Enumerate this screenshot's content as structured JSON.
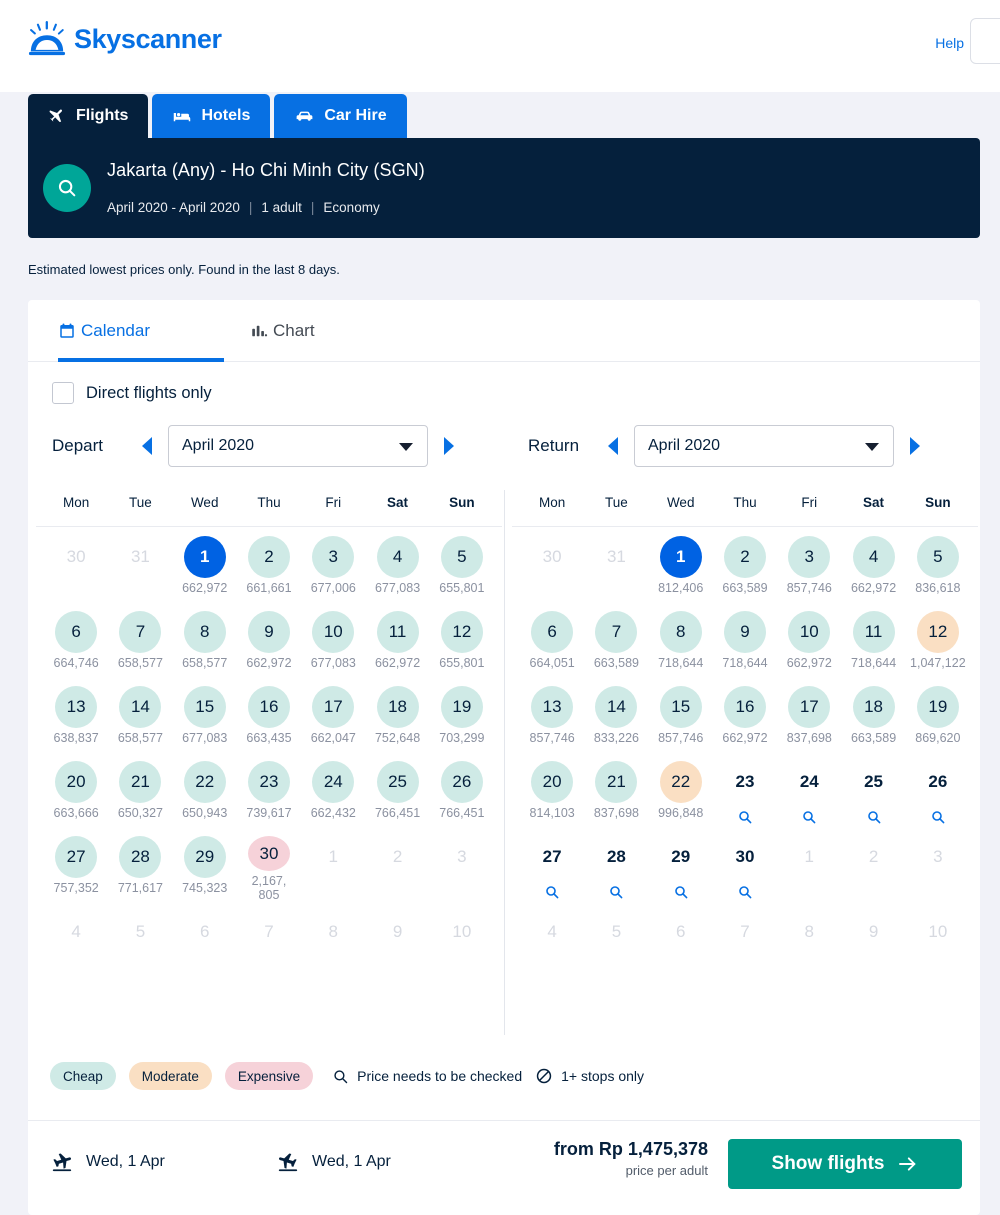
{
  "brand": {
    "name": "Skyscanner",
    "accent": "#0770e3",
    "dark": "#05203c",
    "green": "#009a87"
  },
  "topbar": {
    "help_label": "Help"
  },
  "product_tabs": [
    {
      "label": "Flights",
      "icon": "plane-icon",
      "active": true
    },
    {
      "label": "Hotels",
      "icon": "bed-icon",
      "active": false
    },
    {
      "label": "Car Hire",
      "icon": "car-icon",
      "active": false
    }
  ],
  "search_summary": {
    "route": "Jakarta (Any) - Ho Chi Minh City (SGN)",
    "dates": "April 2020 - April 2020",
    "passengers": "1 adult",
    "cabin": "Economy",
    "icon": "search-icon"
  },
  "estimate_note": "Estimated lowest prices only. Found in the last 8 days.",
  "view_tabs": [
    {
      "label": "Calendar",
      "icon": "calendar-icon",
      "active": true
    },
    {
      "label": "Chart",
      "icon": "bar-chart-icon",
      "active": false
    }
  ],
  "direct_flights": {
    "label": "Direct flights only",
    "checked": false
  },
  "depart": {
    "nav_label": "Depart",
    "month": "April 2020",
    "dow": [
      "Mon",
      "Tue",
      "Wed",
      "Thu",
      "Fri",
      "Sat",
      "Sun"
    ],
    "weeks": [
      [
        {
          "day": "30",
          "state": "muted",
          "price": ""
        },
        {
          "day": "31",
          "state": "muted",
          "price": ""
        },
        {
          "day": "1",
          "state": "selected",
          "price": "662,972"
        },
        {
          "day": "2",
          "state": "cheap",
          "price": "661,661"
        },
        {
          "day": "3",
          "state": "cheap",
          "price": "677,006"
        },
        {
          "day": "4",
          "state": "cheap",
          "price": "677,083"
        },
        {
          "day": "5",
          "state": "cheap",
          "price": "655,801"
        }
      ],
      [
        {
          "day": "6",
          "state": "cheap",
          "price": "664,746"
        },
        {
          "day": "7",
          "state": "cheap",
          "price": "658,577"
        },
        {
          "day": "8",
          "state": "cheap",
          "price": "658,577"
        },
        {
          "day": "9",
          "state": "cheap",
          "price": "662,972"
        },
        {
          "day": "10",
          "state": "cheap",
          "price": "677,083"
        },
        {
          "day": "11",
          "state": "cheap",
          "price": "662,972"
        },
        {
          "day": "12",
          "state": "cheap",
          "price": "655,801"
        }
      ],
      [
        {
          "day": "13",
          "state": "cheap",
          "price": "638,837"
        },
        {
          "day": "14",
          "state": "cheap",
          "price": "658,577"
        },
        {
          "day": "15",
          "state": "cheap",
          "price": "677,083"
        },
        {
          "day": "16",
          "state": "cheap",
          "price": "663,435"
        },
        {
          "day": "17",
          "state": "cheap",
          "price": "662,047"
        },
        {
          "day": "18",
          "state": "cheap",
          "price": "752,648"
        },
        {
          "day": "19",
          "state": "cheap",
          "price": "703,299"
        }
      ],
      [
        {
          "day": "20",
          "state": "cheap",
          "price": "663,666"
        },
        {
          "day": "21",
          "state": "cheap",
          "price": "650,327"
        },
        {
          "day": "22",
          "state": "cheap",
          "price": "650,943"
        },
        {
          "day": "23",
          "state": "cheap",
          "price": "739,617"
        },
        {
          "day": "24",
          "state": "cheap",
          "price": "662,432"
        },
        {
          "day": "25",
          "state": "cheap",
          "price": "766,451"
        },
        {
          "day": "26",
          "state": "cheap",
          "price": "766,451"
        }
      ],
      [
        {
          "day": "27",
          "state": "cheap",
          "price": "757,352"
        },
        {
          "day": "28",
          "state": "cheap",
          "price": "771,617"
        },
        {
          "day": "29",
          "state": "cheap",
          "price": "745,323"
        },
        {
          "day": "30",
          "state": "expensive",
          "price": "2,167, 805"
        },
        {
          "day": "1",
          "state": "muted",
          "price": ""
        },
        {
          "day": "2",
          "state": "muted",
          "price": ""
        },
        {
          "day": "3",
          "state": "muted",
          "price": ""
        }
      ],
      [
        {
          "day": "4",
          "state": "muted",
          "price": ""
        },
        {
          "day": "5",
          "state": "muted",
          "price": ""
        },
        {
          "day": "6",
          "state": "muted",
          "price": ""
        },
        {
          "day": "7",
          "state": "muted",
          "price": ""
        },
        {
          "day": "8",
          "state": "muted",
          "price": ""
        },
        {
          "day": "9",
          "state": "muted",
          "price": ""
        },
        {
          "day": "10",
          "state": "muted",
          "price": ""
        }
      ]
    ]
  },
  "return": {
    "nav_label": "Return",
    "month": "April 2020",
    "dow": [
      "Mon",
      "Tue",
      "Wed",
      "Thu",
      "Fri",
      "Sat",
      "Sun"
    ],
    "weeks": [
      [
        {
          "day": "30",
          "state": "muted",
          "price": ""
        },
        {
          "day": "31",
          "state": "muted",
          "price": ""
        },
        {
          "day": "1",
          "state": "selected",
          "price": "812,406"
        },
        {
          "day": "2",
          "state": "cheap",
          "price": "663,589"
        },
        {
          "day": "3",
          "state": "cheap",
          "price": "857,746"
        },
        {
          "day": "4",
          "state": "cheap",
          "price": "662,972"
        },
        {
          "day": "5",
          "state": "cheap",
          "price": "836,618"
        }
      ],
      [
        {
          "day": "6",
          "state": "cheap",
          "price": "664,051"
        },
        {
          "day": "7",
          "state": "cheap",
          "price": "663,589"
        },
        {
          "day": "8",
          "state": "cheap",
          "price": "718,644"
        },
        {
          "day": "9",
          "state": "cheap",
          "price": "718,644"
        },
        {
          "day": "10",
          "state": "cheap",
          "price": "662,972"
        },
        {
          "day": "11",
          "state": "cheap",
          "price": "718,644"
        },
        {
          "day": "12",
          "state": "moderate",
          "price": "1,047,122"
        }
      ],
      [
        {
          "day": "13",
          "state": "cheap",
          "price": "857,746"
        },
        {
          "day": "14",
          "state": "cheap",
          "price": "833,226"
        },
        {
          "day": "15",
          "state": "cheap",
          "price": "857,746"
        },
        {
          "day": "16",
          "state": "cheap",
          "price": "662,972"
        },
        {
          "day": "17",
          "state": "cheap",
          "price": "837,698"
        },
        {
          "day": "18",
          "state": "cheap",
          "price": "663,589"
        },
        {
          "day": "19",
          "state": "cheap",
          "price": "869,620"
        }
      ],
      [
        {
          "day": "20",
          "state": "cheap",
          "price": "814,103"
        },
        {
          "day": "21",
          "state": "cheap",
          "price": "837,698"
        },
        {
          "day": "22",
          "state": "moderate",
          "price": "996,848"
        },
        {
          "day": "23",
          "state": "plain",
          "price": "",
          "search": true
        },
        {
          "day": "24",
          "state": "plain",
          "price": "",
          "search": true
        },
        {
          "day": "25",
          "state": "plain",
          "price": "",
          "search": true
        },
        {
          "day": "26",
          "state": "plain",
          "price": "",
          "search": true
        }
      ],
      [
        {
          "day": "27",
          "state": "plain",
          "price": "",
          "search": true
        },
        {
          "day": "28",
          "state": "plain",
          "price": "",
          "search": true
        },
        {
          "day": "29",
          "state": "plain",
          "price": "",
          "search": true
        },
        {
          "day": "30",
          "state": "plain",
          "price": "",
          "search": true
        },
        {
          "day": "1",
          "state": "muted",
          "price": ""
        },
        {
          "day": "2",
          "state": "muted",
          "price": ""
        },
        {
          "day": "3",
          "state": "muted",
          "price": ""
        }
      ],
      [
        {
          "day": "4",
          "state": "muted",
          "price": ""
        },
        {
          "day": "5",
          "state": "muted",
          "price": ""
        },
        {
          "day": "6",
          "state": "muted",
          "price": ""
        },
        {
          "day": "7",
          "state": "muted",
          "price": ""
        },
        {
          "day": "8",
          "state": "muted",
          "price": ""
        },
        {
          "day": "9",
          "state": "muted",
          "price": ""
        },
        {
          "day": "10",
          "state": "muted",
          "price": ""
        }
      ]
    ]
  },
  "legend": {
    "cheap": "Cheap",
    "moderate": "Moderate",
    "expensive": "Expensive",
    "price_check": "Price needs to be checked",
    "stops": "1+ stops only"
  },
  "footer": {
    "outbound_date": "Wed, 1 Apr",
    "inbound_date": "Wed, 1 Apr",
    "price_from": "from Rp 1,475,378",
    "price_sub": "price per adult",
    "cta": "Show flights"
  },
  "colors": {
    "cheap": "#cfeae6",
    "moderate": "#fadfc3",
    "expensive": "#f6d2d9",
    "selected": "#0062e3"
  }
}
